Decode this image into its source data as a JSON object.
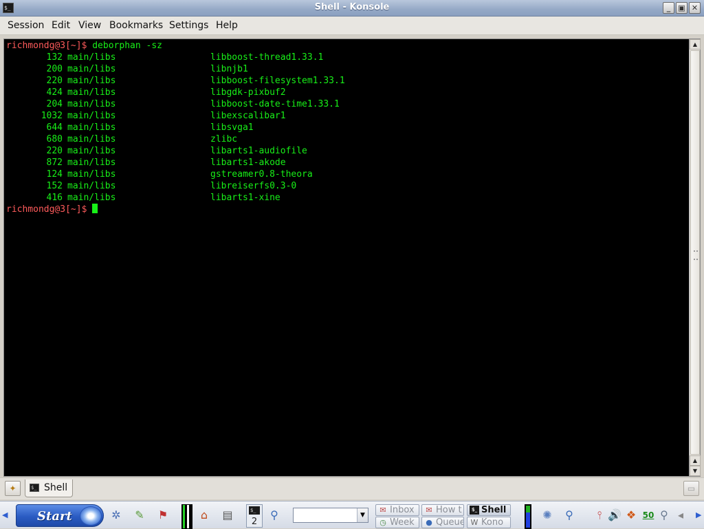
{
  "window": {
    "title": "Shell - Konsole",
    "icon": "terminal-icon"
  },
  "menu": [
    "Session",
    "Edit",
    "View",
    "Bookmarks",
    "Settings",
    "Help"
  ],
  "terminal": {
    "prompt_user": "richmondg@3[~]$",
    "command": "deborphan -sz",
    "rows": [
      {
        "size": "132",
        "section": "main/libs",
        "package": "libboost-thread1.33.1"
      },
      {
        "size": "200",
        "section": "main/libs",
        "package": "libnjb1"
      },
      {
        "size": "220",
        "section": "main/libs",
        "package": "libboost-filesystem1.33.1"
      },
      {
        "size": "424",
        "section": "main/libs",
        "package": "libgdk-pixbuf2"
      },
      {
        "size": "204",
        "section": "main/libs",
        "package": "libboost-date-time1.33.1"
      },
      {
        "size": "1032",
        "section": "main/libs",
        "package": "libexscalibar1"
      },
      {
        "size": "644",
        "section": "main/libs",
        "package": "libsvga1"
      },
      {
        "size": "680",
        "section": "main/libs",
        "package": "zlibc"
      },
      {
        "size": "220",
        "section": "main/libs",
        "package": "libarts1-audiofile"
      },
      {
        "size": "872",
        "section": "main/libs",
        "package": "libarts1-akode"
      },
      {
        "size": "124",
        "section": "main/libs",
        "package": "gstreamer0.8-theora"
      },
      {
        "size": "152",
        "section": "main/libs",
        "package": "libreiserfs0.3-0"
      },
      {
        "size": "416",
        "section": "main/libs",
        "package": "libarts1-xine"
      }
    ],
    "final_prompt": "richmondg@3[~]$"
  },
  "tabs": [
    {
      "label": "Shell"
    }
  ],
  "taskbar": {
    "start_label": "Start",
    "desktop_number": "2",
    "tasks": [
      {
        "label": "Inbox",
        "icon": "mail-icon",
        "active": false
      },
      {
        "label": "How t",
        "icon": "mail-icon",
        "active": false
      },
      {
        "label": "Shell",
        "icon": "terminal-icon",
        "active": true
      },
      {
        "label": "Week",
        "icon": "clock-icon",
        "active": false
      },
      {
        "label": "Queue",
        "icon": "globe-icon",
        "active": false
      },
      {
        "label": "Kono",
        "icon": "wiki-icon",
        "active": false
      }
    ],
    "tray_text": "50"
  },
  "colors": {
    "terminal_bg": "#000000",
    "terminal_fg": "#18f018",
    "prompt": "#ff5b5b"
  }
}
